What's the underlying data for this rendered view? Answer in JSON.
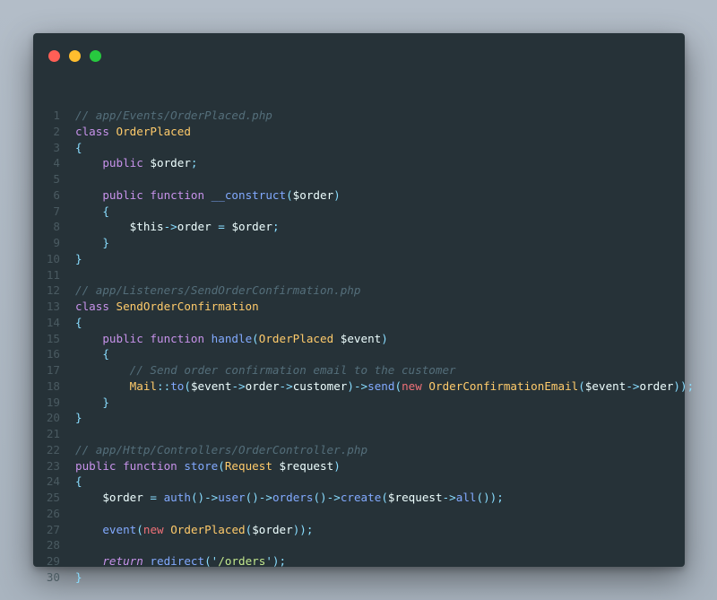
{
  "window": {
    "controls": [
      "close",
      "minimize",
      "zoom"
    ],
    "colors": {
      "close": "#ff5f56",
      "minimize": "#ffbd2e",
      "zoom": "#27c93f",
      "background": "#263238"
    }
  },
  "code": {
    "line_numbers": [
      "1",
      "2",
      "3",
      "4",
      "5",
      "6",
      "7",
      "8",
      "9",
      "10",
      "11",
      "12",
      "13",
      "14",
      "15",
      "16",
      "17",
      "18",
      "19",
      "20",
      "21",
      "22",
      "23",
      "24",
      "25",
      "26",
      "27",
      "28",
      "29",
      "30"
    ],
    "lines": [
      [
        [
          "c-comment",
          "// app/Events/OrderPlaced.php"
        ]
      ],
      [
        [
          "c-keyword",
          "class "
        ],
        [
          "c-class",
          "OrderPlaced"
        ]
      ],
      [
        [
          "c-punct",
          "{"
        ]
      ],
      [
        [
          "c-plain",
          "    "
        ],
        [
          "c-keyword",
          "public "
        ],
        [
          "c-var",
          "$order"
        ],
        [
          "c-punct",
          ";"
        ]
      ],
      [],
      [
        [
          "c-plain",
          "    "
        ],
        [
          "c-keyword",
          "public "
        ],
        [
          "c-keyword",
          "function "
        ],
        [
          "c-func",
          "__construct"
        ],
        [
          "c-punct",
          "("
        ],
        [
          "c-var",
          "$order"
        ],
        [
          "c-punct",
          ")"
        ]
      ],
      [
        [
          "c-plain",
          "    "
        ],
        [
          "c-punct",
          "{"
        ]
      ],
      [
        [
          "c-plain",
          "        "
        ],
        [
          "c-var",
          "$this"
        ],
        [
          "c-punct",
          "->"
        ],
        [
          "c-plain",
          "order "
        ],
        [
          "c-punct",
          "= "
        ],
        [
          "c-var",
          "$order"
        ],
        [
          "c-punct",
          ";"
        ]
      ],
      [
        [
          "c-plain",
          "    "
        ],
        [
          "c-punct",
          "}"
        ]
      ],
      [
        [
          "c-punct",
          "}"
        ]
      ],
      [],
      [
        [
          "c-comment",
          "// app/Listeners/SendOrderConfirmation.php"
        ]
      ],
      [
        [
          "c-keyword",
          "class "
        ],
        [
          "c-class",
          "SendOrderConfirmation"
        ]
      ],
      [
        [
          "c-punct",
          "{"
        ]
      ],
      [
        [
          "c-plain",
          "    "
        ],
        [
          "c-keyword",
          "public "
        ],
        [
          "c-keyword",
          "function "
        ],
        [
          "c-func",
          "handle"
        ],
        [
          "c-punct",
          "("
        ],
        [
          "c-class",
          "OrderPlaced "
        ],
        [
          "c-var",
          "$event"
        ],
        [
          "c-punct",
          ")"
        ]
      ],
      [
        [
          "c-plain",
          "    "
        ],
        [
          "c-punct",
          "{"
        ]
      ],
      [
        [
          "c-plain",
          "        "
        ],
        [
          "c-comment",
          "// Send order confirmation email to the customer"
        ]
      ],
      [
        [
          "c-plain",
          "        "
        ],
        [
          "c-class",
          "Mail"
        ],
        [
          "c-punct",
          "::"
        ],
        [
          "c-func",
          "to"
        ],
        [
          "c-punct",
          "("
        ],
        [
          "c-var",
          "$event"
        ],
        [
          "c-punct",
          "->"
        ],
        [
          "c-plain",
          "order"
        ],
        [
          "c-punct",
          "->"
        ],
        [
          "c-plain",
          "customer"
        ],
        [
          "c-punct",
          ")->"
        ],
        [
          "c-func",
          "send"
        ],
        [
          "c-punct",
          "("
        ],
        [
          "c-new",
          "new "
        ],
        [
          "c-class",
          "OrderConfirmationEmail"
        ],
        [
          "c-punct",
          "("
        ],
        [
          "c-var",
          "$event"
        ],
        [
          "c-punct",
          "->"
        ],
        [
          "c-plain",
          "order"
        ],
        [
          "c-punct",
          "));"
        ]
      ],
      [
        [
          "c-plain",
          "    "
        ],
        [
          "c-punct",
          "}"
        ]
      ],
      [
        [
          "c-punct",
          "}"
        ]
      ],
      [],
      [
        [
          "c-comment",
          "// app/Http/Controllers/OrderController.php"
        ]
      ],
      [
        [
          "c-keyword",
          "public "
        ],
        [
          "c-keyword",
          "function "
        ],
        [
          "c-func",
          "store"
        ],
        [
          "c-punct",
          "("
        ],
        [
          "c-class",
          "Request "
        ],
        [
          "c-var",
          "$request"
        ],
        [
          "c-punct",
          ")"
        ]
      ],
      [
        [
          "c-punct",
          "{"
        ]
      ],
      [
        [
          "c-plain",
          "    "
        ],
        [
          "c-var",
          "$order "
        ],
        [
          "c-punct",
          "= "
        ],
        [
          "c-func",
          "auth"
        ],
        [
          "c-punct",
          "()->"
        ],
        [
          "c-func",
          "user"
        ],
        [
          "c-punct",
          "()->"
        ],
        [
          "c-func",
          "orders"
        ],
        [
          "c-punct",
          "()->"
        ],
        [
          "c-func",
          "create"
        ],
        [
          "c-punct",
          "("
        ],
        [
          "c-var",
          "$request"
        ],
        [
          "c-punct",
          "->"
        ],
        [
          "c-func",
          "all"
        ],
        [
          "c-punct",
          "());"
        ]
      ],
      [],
      [
        [
          "c-plain",
          "    "
        ],
        [
          "c-func",
          "event"
        ],
        [
          "c-punct",
          "("
        ],
        [
          "c-new",
          "new "
        ],
        [
          "c-class",
          "OrderPlaced"
        ],
        [
          "c-punct",
          "("
        ],
        [
          "c-var",
          "$order"
        ],
        [
          "c-punct",
          "));"
        ]
      ],
      [],
      [
        [
          "c-plain",
          "    "
        ],
        [
          "c-return",
          "return "
        ],
        [
          "c-func",
          "redirect"
        ],
        [
          "c-punct",
          "('"
        ],
        [
          "c-string",
          "/orders"
        ],
        [
          "c-punct",
          "');"
        ]
      ],
      [
        [
          "c-punct",
          "}"
        ]
      ]
    ]
  }
}
